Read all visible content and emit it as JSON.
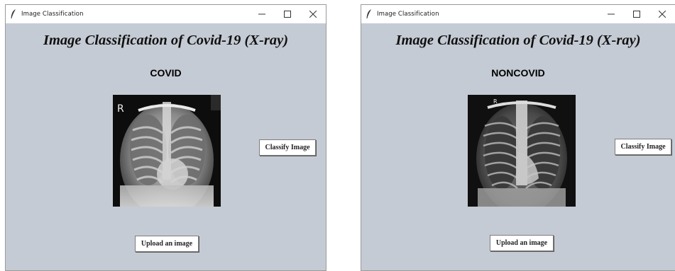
{
  "windows": [
    {
      "title": "Image Classification",
      "heading": "Image Classification of Covid-19 (X-ray)",
      "result": "COVID",
      "image_label": "R",
      "classify_label": "Classify Image",
      "upload_label": "Upload an image",
      "icons": [
        "feather-icon",
        "minimize-icon",
        "maximize-icon",
        "close-icon"
      ]
    },
    {
      "title": "Image Classification",
      "heading": "Image Classification of Covid-19 (X-ray)",
      "result": "NONCOVID",
      "image_label": "R",
      "classify_label": "Classify Image",
      "upload_label": "Upload an image",
      "icons": [
        "feather-icon",
        "minimize-icon",
        "maximize-icon",
        "close-icon"
      ]
    }
  ],
  "colors": {
    "window_background": "#c5cbd4",
    "titlebar": "#ffffff",
    "button": "#ffffff"
  }
}
